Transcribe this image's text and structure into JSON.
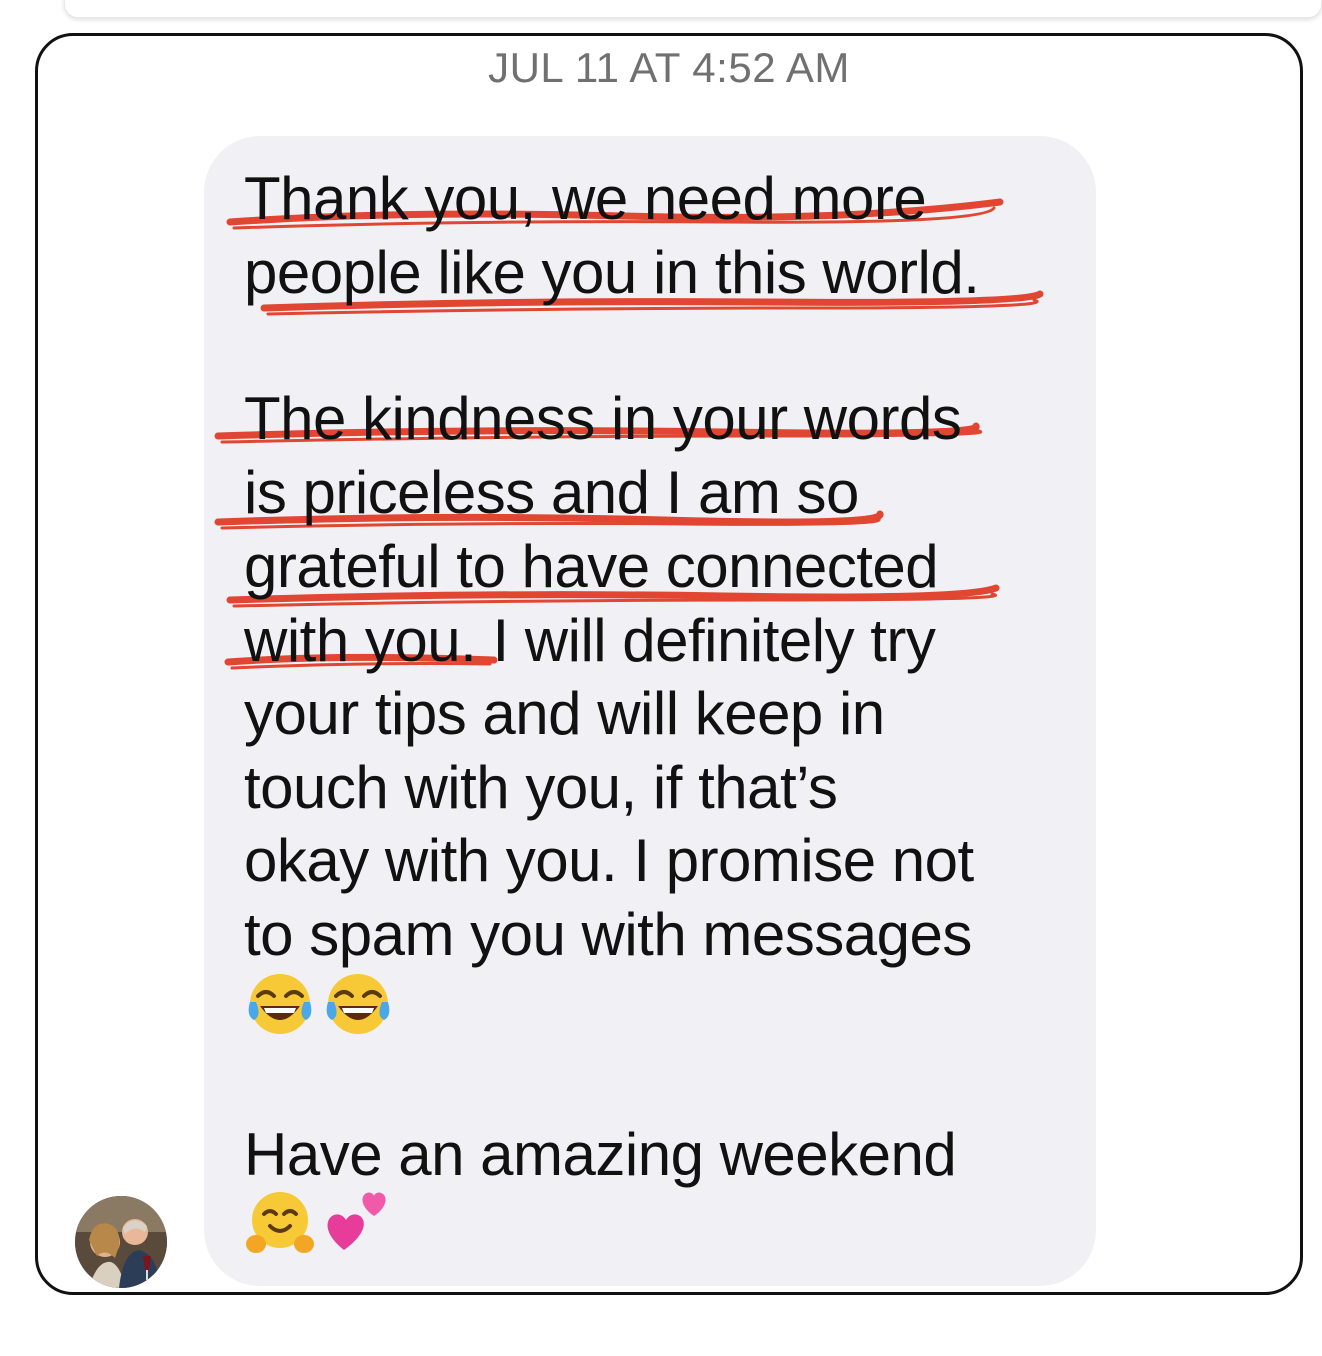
{
  "conversation": {
    "timestamp": "JUL 11 AT 4:52 AM"
  },
  "message": {
    "lines": [
      "Thank you, we need more",
      "people like you in this world.",
      "The kindness in your words",
      "is priceless and I am so",
      "grateful to have connected",
      "with you. I will definitely try",
      "your tips and will keep in",
      "touch with you, if that’s",
      "okay with you. I promise not",
      "to spam you with messages",
      "Have an amazing weekend"
    ],
    "emoji_row_1": [
      "face-with-tears-of-joy-icon",
      "face-with-tears-of-joy-icon"
    ],
    "emoji_row_2": [
      "hugging-face-icon",
      "two-hearts-icon"
    ]
  },
  "colors": {
    "bubble": "#f1f1f5",
    "underline": "#e0341e",
    "timestamp": "#707070",
    "frame": "#111111"
  }
}
